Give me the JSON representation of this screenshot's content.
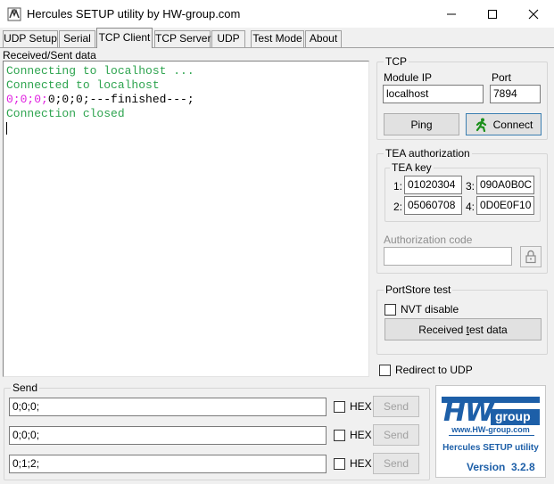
{
  "window": {
    "title": "Hercules SETUP utility by HW-group.com",
    "controls": {
      "minimize": "—",
      "maximize": "☐",
      "close": "✕"
    }
  },
  "tabs": [
    {
      "label": "UDP Setup"
    },
    {
      "label": "Serial"
    },
    {
      "label": "TCP Client",
      "active": true
    },
    {
      "label": "TCP Server"
    },
    {
      "label": "UDP"
    },
    {
      "label": "Test Mode"
    },
    {
      "label": "About"
    }
  ],
  "received": {
    "label": "Received/Sent data",
    "lines": [
      {
        "text": "Connecting to localhost ...",
        "color": "#2ea44f"
      },
      {
        "text": "Connected to localhost",
        "color": "#2ea44f"
      },
      {
        "magenta": "0;0;0;",
        "black": "0;0;0;---finished---;"
      },
      {
        "text": "Connection closed",
        "color": "#2ea44f"
      }
    ]
  },
  "tcp": {
    "group_title": "TCP",
    "module_ip_label": "Module IP",
    "module_ip_value": "localhost",
    "port_label": "Port",
    "port_value": "7894",
    "ping_label": "Ping",
    "connect_label": "Connect"
  },
  "tea": {
    "group_title": "TEA authorization",
    "key_group_title": "TEA key",
    "keys": [
      {
        "index": "1:",
        "value": "01020304"
      },
      {
        "index": "3:",
        "value": "090A0B0C"
      },
      {
        "index": "2:",
        "value": "05060708"
      },
      {
        "index": "4:",
        "value": "0D0E0F10"
      }
    ],
    "auth_code_label": "Authorization code",
    "auth_code_value": ""
  },
  "portstore": {
    "group_title": "PortStore test",
    "nvt_label": "NVT disable",
    "received_test_label_pre": "Received ",
    "received_test_label_u": "t",
    "received_test_label_post": "est data"
  },
  "redirect_label": "Redirect to UDP",
  "send": {
    "group_title": "Send",
    "rows": [
      {
        "value": "0;0;0;",
        "hex_label": "HEX",
        "send_label": "Send"
      },
      {
        "value": "0;0;0;",
        "hex_label": "HEX",
        "send_label": "Send"
      },
      {
        "value": "0;1;2;",
        "hex_label": "HEX",
        "send_label": "Send"
      }
    ]
  },
  "logo": {
    "brand": "HW",
    "group": "group",
    "url": "www.HW-group.com",
    "product": "Hercules SETUP utility",
    "version_label": "Version",
    "version": "3.2.8",
    "brand_color": "#1d5fa8"
  }
}
